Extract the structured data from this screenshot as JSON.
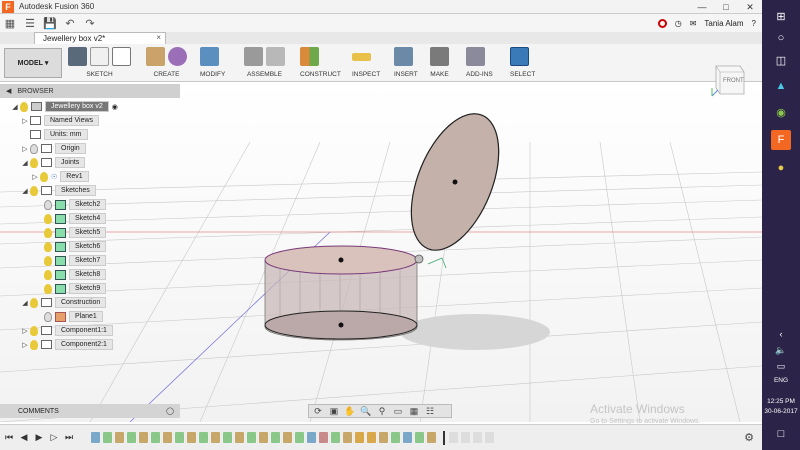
{
  "app": {
    "window_title": "Autodesk Fusion 360",
    "logo_letter": "F"
  },
  "quick_access": {
    "user_name": "Tania Alam",
    "help_label": "?"
  },
  "document_tab": {
    "title": "Jewellery box v2*"
  },
  "toolbar": {
    "workspace": "MODEL",
    "groups": [
      {
        "label": "SKETCH"
      },
      {
        "label": "CREATE"
      },
      {
        "label": "MODIFY"
      },
      {
        "label": "ASSEMBLE"
      },
      {
        "label": "CONSTRUCT"
      },
      {
        "label": "INSPECT"
      },
      {
        "label": "INSERT"
      },
      {
        "label": "MAKE"
      },
      {
        "label": "ADD-INS"
      },
      {
        "label": "SELECT"
      }
    ]
  },
  "viewcube": {
    "face_label": "FRONT"
  },
  "browser": {
    "header": "BROWSER",
    "nodes": [
      {
        "label": "Jewellery box v2"
      },
      {
        "label": "Named Views"
      },
      {
        "label": "Units: mm"
      },
      {
        "label": "Origin"
      },
      {
        "label": "Joints"
      },
      {
        "label": "Rev1"
      },
      {
        "label": "Sketches"
      },
      {
        "label": "Sketch2"
      },
      {
        "label": "Sketch4"
      },
      {
        "label": "Sketch5"
      },
      {
        "label": "Sketch6"
      },
      {
        "label": "Sketch7"
      },
      {
        "label": "Sketch8"
      },
      {
        "label": "Sketch9"
      },
      {
        "label": "Construction"
      },
      {
        "label": "Plane1"
      },
      {
        "label": "Component1:1"
      },
      {
        "label": "Component2:1"
      }
    ]
  },
  "comments": {
    "label": "COMMENTS"
  },
  "watermark": {
    "title": "Activate Windows",
    "subtitle": "Go to Settings to activate Windows."
  },
  "taskbar": {
    "language": "ENG",
    "time": "12:25 PM",
    "date": "30-06-2017"
  },
  "colors": {
    "taskbar_bg": "#2c2448",
    "toolbar_bg": "#f4f4f4",
    "box_body": "#c9b8b8",
    "lid_fill": "#c4b2aa",
    "accent_orange": "#f26722"
  }
}
